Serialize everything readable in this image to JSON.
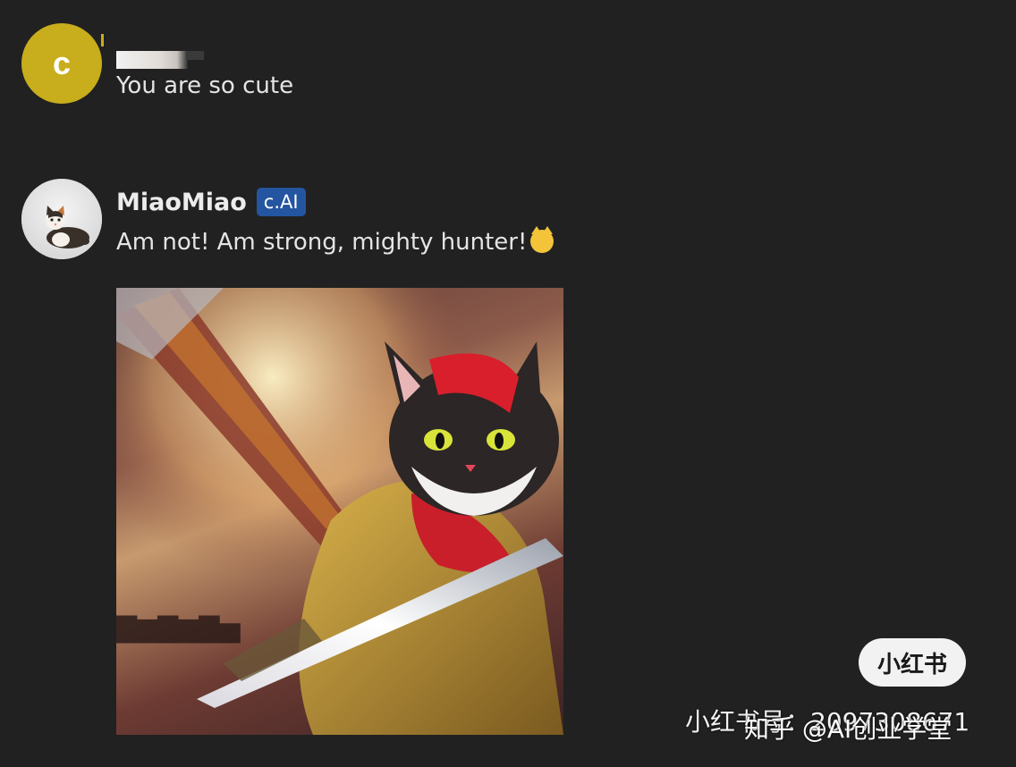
{
  "messages": [
    {
      "role": "user",
      "avatar_letter": "c",
      "avatar_color": "#c8ad1c",
      "text": "You are so cute"
    },
    {
      "role": "character",
      "name": "MiaoMiao",
      "badge": "c.AI",
      "badge_color": "#2455a0",
      "text": "Am not! Am strong, mighty hunter!",
      "emoji": "smirking-cat-face",
      "avatar_icon": "kitten-photo",
      "image": "cat-warrior-with-sword"
    }
  ],
  "watermarks": {
    "xiaohongshu_logo": "小红书",
    "xiaohongshu_id": "小红书号：2097308671",
    "zhihu": "知乎 @AI创业学堂"
  }
}
